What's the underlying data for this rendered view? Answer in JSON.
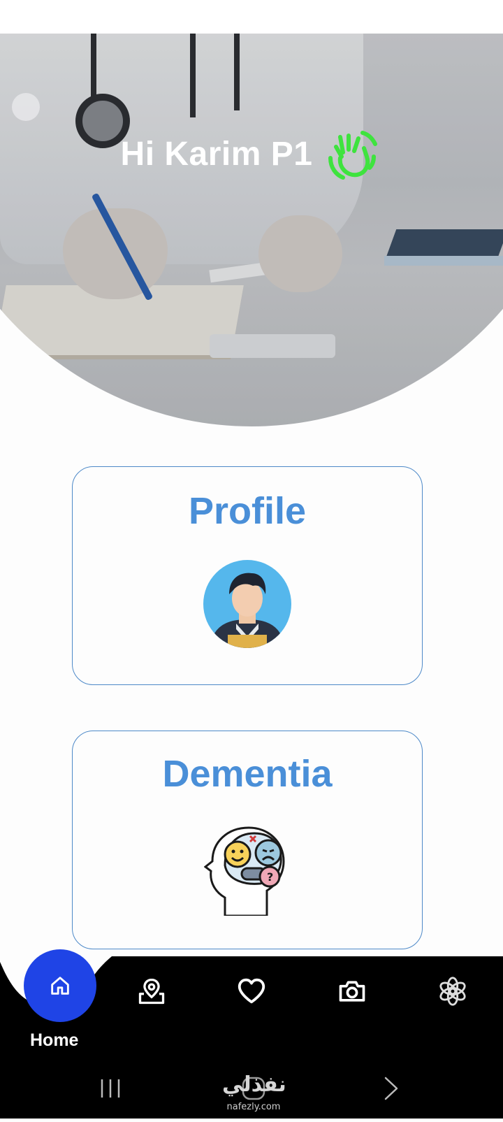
{
  "header": {
    "greeting": "Hi Karim P1",
    "greeting_icon": "waving-hand-icon",
    "accent_color": "#3ee33e"
  },
  "cards": [
    {
      "title": "Profile",
      "icon": "avatar-icon"
    },
    {
      "title": "Dementia",
      "icon": "brain-emotions-icon"
    }
  ],
  "bottom_nav": {
    "active_label": "Home",
    "active_color": "#1f44e6",
    "items": [
      "home-icon",
      "map-pin-icon",
      "heart-icon",
      "camera-icon",
      "ai-knot-icon"
    ]
  },
  "system_nav": {
    "watermark": "نفذلي",
    "watermark_sub": "nafezly.com"
  }
}
